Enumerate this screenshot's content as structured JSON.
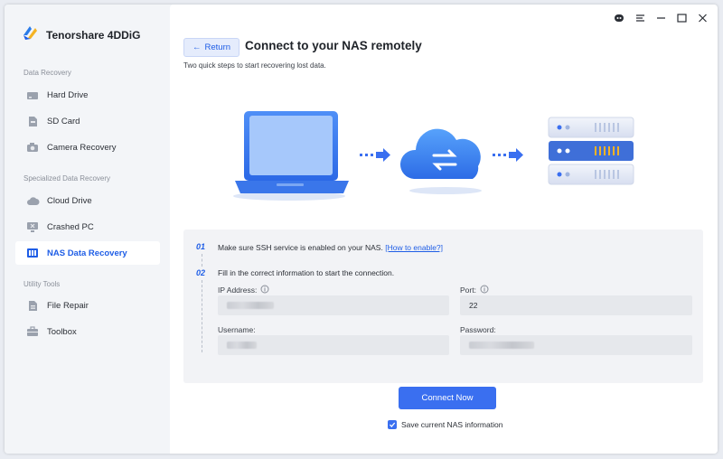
{
  "app": {
    "name": "Tenorshare 4DDiG"
  },
  "sidebar": {
    "sections": [
      {
        "label": "Data Recovery",
        "items": [
          {
            "label": "Hard Drive",
            "icon": "hard-drive-icon"
          },
          {
            "label": "SD Card",
            "icon": "sd-card-icon"
          },
          {
            "label": "Camera Recovery",
            "icon": "camera-icon"
          }
        ]
      },
      {
        "label": "Specialized Data Recovery",
        "items": [
          {
            "label": "Cloud Drive",
            "icon": "cloud-icon"
          },
          {
            "label": "Crashed PC",
            "icon": "crashed-pc-icon"
          },
          {
            "label": "NAS Data Recovery",
            "icon": "nas-icon",
            "active": true
          }
        ]
      },
      {
        "label": "Utility Tools",
        "items": [
          {
            "label": "File Repair",
            "icon": "file-repair-icon"
          },
          {
            "label": "Toolbox",
            "icon": "toolbox-icon"
          }
        ]
      }
    ]
  },
  "header": {
    "back_label": "Return",
    "title": "Connect to your NAS remotely",
    "subtitle": "Two quick steps to start recovering lost data."
  },
  "steps": [
    {
      "num": "01",
      "text": "Make sure SSH service is enabled on your NAS.",
      "link": "[How to enable?]"
    },
    {
      "num": "02",
      "text": "Fill in the correct information to start the connection."
    }
  ],
  "form": {
    "ip_label": "IP Address:",
    "port_label": "Port:",
    "port_value": "22",
    "username_label": "Username:",
    "password_label": "Password:"
  },
  "connect_label": "Connect Now",
  "save_info": {
    "label": "Save current NAS information",
    "checked": true
  },
  "colors": {
    "accent": "#3a6ff0",
    "link": "#1e5de6",
    "panel": "#f2f3f6"
  }
}
